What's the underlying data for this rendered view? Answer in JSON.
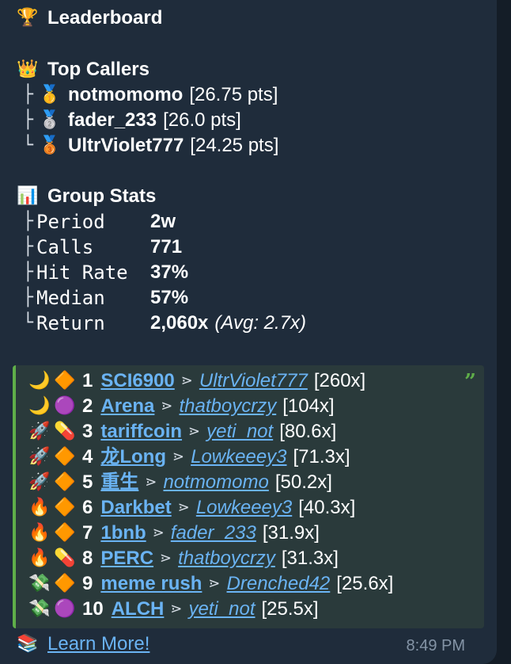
{
  "title": {
    "icon": "trophy-icon",
    "glyph": "🏆",
    "text": "Leaderboard"
  },
  "top_callers": {
    "icon": "crown-icon",
    "glyph": "👑",
    "heading": "Top Callers",
    "items": [
      {
        "tree": "├",
        "medal": "first-place-medal-icon",
        "medal_glyph": "🥇",
        "name": "notmomomo",
        "pts": "[26.75 pts]"
      },
      {
        "tree": "├",
        "medal": "second-place-medal-icon",
        "medal_glyph": "🥈",
        "name": "fader_233",
        "pts": "[26.0 pts]"
      },
      {
        "tree": "└",
        "medal": "third-place-medal-icon",
        "medal_glyph": "🥉",
        "name": "UltrViolet777",
        "pts": "[24.25 pts]"
      }
    ]
  },
  "group_stats": {
    "icon": "bar-chart-icon",
    "glyph": "📊",
    "heading": "Group Stats",
    "items": [
      {
        "tree": "├",
        "label": "Period",
        "value": "2w"
      },
      {
        "tree": "├",
        "label": "Calls",
        "value": "771"
      },
      {
        "tree": "├",
        "label": "Hit Rate",
        "value": "37%"
      },
      {
        "tree": "├",
        "label": "Median",
        "value": "57%"
      },
      {
        "tree": "└",
        "label": "Return",
        "value": "2,060x",
        "extra": "(Avg: 2.7x)"
      }
    ]
  },
  "calls": {
    "quote_glyph": "”",
    "rows": [
      {
        "icon1": "crescent-moon-icon",
        "g1": "🌙",
        "icon2": "orange-diamond-icon",
        "g2": "🔶",
        "rank": "1",
        "token": "SCI6900",
        "arrow": "⋗",
        "caller": "UltrViolet777",
        "mult": "[260x]"
      },
      {
        "icon1": "crescent-moon-icon",
        "g1": "🌙",
        "icon2": "purple-circle-icon",
        "g2": "🟣",
        "rank": "2",
        "token": "Arena",
        "arrow": "⋗",
        "caller": "thatboycrzy",
        "mult": "[104x]"
      },
      {
        "icon1": "rocket-icon",
        "g1": "🚀",
        "icon2": "pill-icon",
        "g2": "💊",
        "rank": "3",
        "token": "tariffcoin",
        "arrow": "⋗",
        "caller": "yeti_not",
        "mult": "[80.6x]"
      },
      {
        "icon1": "rocket-icon",
        "g1": "🚀",
        "icon2": "orange-diamond-icon",
        "g2": "🔶",
        "rank": "4",
        "token": "龙Long",
        "arrow": "⋗",
        "caller": "Lowkeeey3",
        "mult": "[71.3x]"
      },
      {
        "icon1": "rocket-icon",
        "g1": "🚀",
        "icon2": "orange-diamond-icon",
        "g2": "🔶",
        "rank": "5",
        "token": "重生",
        "arrow": "⋗",
        "caller": "notmomomo",
        "mult": "[50.2x]"
      },
      {
        "icon1": "fire-icon",
        "g1": "🔥",
        "icon2": "orange-diamond-icon",
        "g2": "🔶",
        "rank": "6",
        "token": "Darkbet",
        "arrow": "⋗",
        "caller": "Lowkeeey3",
        "mult": "[40.3x]"
      },
      {
        "icon1": "fire-icon",
        "g1": "🔥",
        "icon2": "orange-diamond-icon",
        "g2": "🔶",
        "rank": "7",
        "token": "1bnb",
        "arrow": "⋗",
        "caller": "fader_233",
        "mult": "[31.9x]"
      },
      {
        "icon1": "fire-icon",
        "g1": "🔥",
        "icon2": "pill-icon",
        "g2": "💊",
        "rank": "8",
        "token": "PERC",
        "arrow": "⋗",
        "caller": "thatboycrzy",
        "mult": "[31.3x]"
      },
      {
        "icon1": "money-wings-icon",
        "g1": "💸",
        "icon2": "orange-diamond-icon",
        "g2": "🔶",
        "rank": "9",
        "token": "meme rush",
        "arrow": "⋗",
        "caller": "Drenched42",
        "mult": "[25.6x]"
      },
      {
        "icon1": "money-wings-icon",
        "g1": "💸",
        "icon2": "purple-circle-icon",
        "g2": "🟣",
        "rank": "10",
        "token": "ALCH",
        "arrow": "⋗",
        "caller": "yeti_not",
        "mult": "[25.5x]"
      }
    ]
  },
  "footer": {
    "icon": "books-icon",
    "glyph": "📚",
    "link_text": "Learn More!",
    "time": "8:49 PM"
  }
}
